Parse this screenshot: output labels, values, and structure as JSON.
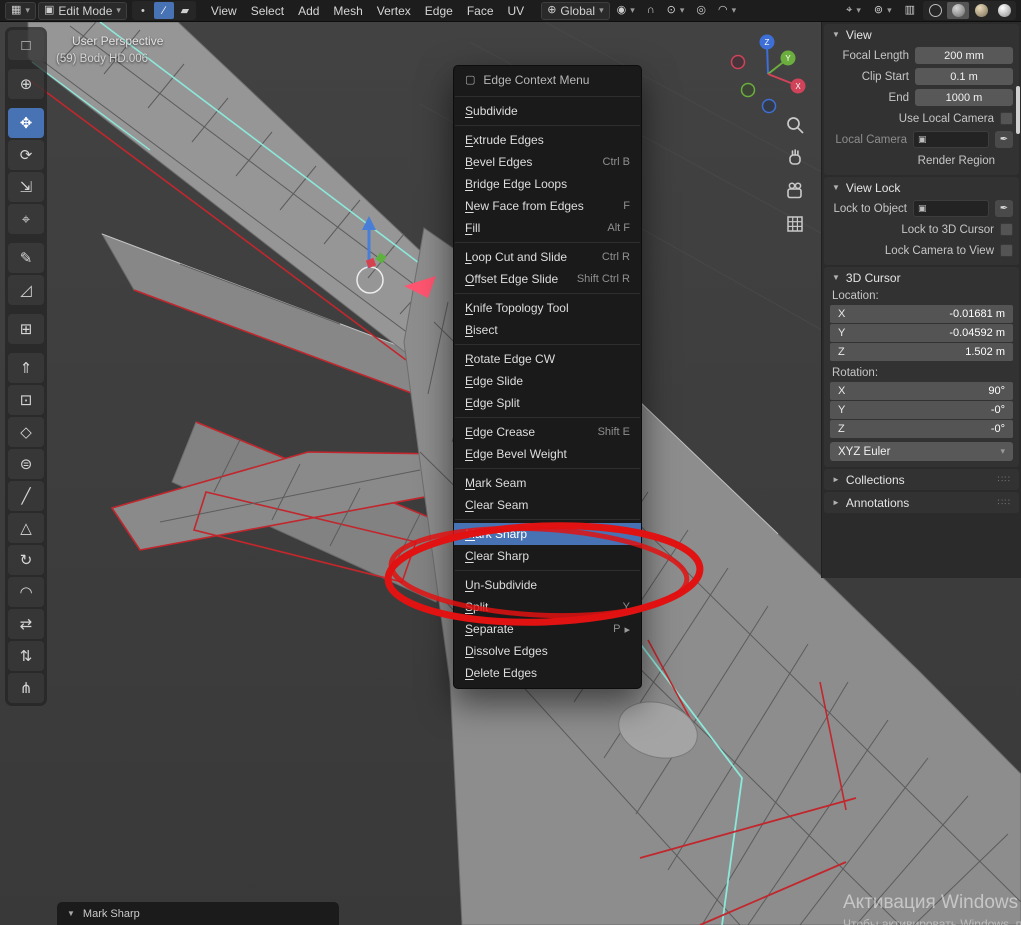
{
  "topbar": {
    "mode": "Edit Mode",
    "menus": [
      "View",
      "Select",
      "Add",
      "Mesh",
      "Vertex",
      "Edge",
      "Face",
      "UV"
    ],
    "orientation": "Global"
  },
  "icons": {
    "chevron_down": "▾",
    "editor_type": "▦",
    "mode_cube": "▣",
    "vertex_select": "•",
    "edge_select": "∕",
    "face_select": "▰",
    "orientation_globe": "⊕",
    "pivot_point": "◉",
    "snap_magnet": "∩",
    "snap_target": "⊙",
    "proportional_edit": "◎",
    "falloff": "◠",
    "gizmo_toggle": "⌖",
    "overlays_toggle": "⊚",
    "xray_toggle": "▥",
    "menu_header": "▢",
    "object_cube": "▣",
    "eyedropper": "✒",
    "triangle_down": "▼",
    "triangle_right": "►",
    "grip": "∷∷"
  },
  "viewport": {
    "perspective_label": "User Perspective",
    "object_label": "(59) Body HD.006",
    "axis_labels": {
      "x": "X",
      "y": "Y",
      "z": "Z"
    }
  },
  "colors": {
    "selection_blue": "#4772b3",
    "seam_red": "#c1272d",
    "sharp_cyan": "#8ce8da",
    "annotation_red": "#e11212"
  },
  "toolbox": {
    "tools": [
      {
        "name": "select-box",
        "glyph": "□"
      },
      {
        "name": "cursor",
        "glyph": "⊕",
        "gap": true
      },
      {
        "name": "move",
        "glyph": "✥",
        "gap": true,
        "active": true
      },
      {
        "name": "rotate",
        "glyph": "⟳"
      },
      {
        "name": "scale",
        "glyph": "⇲"
      },
      {
        "name": "transform",
        "glyph": "⌖"
      },
      {
        "name": "annotate",
        "glyph": "✎",
        "gap": true
      },
      {
        "name": "measure",
        "glyph": "◿"
      },
      {
        "name": "add-cube",
        "glyph": "⊞",
        "gap": true
      },
      {
        "name": "extrude-region",
        "glyph": "⇑",
        "gap": true
      },
      {
        "name": "inset-faces",
        "glyph": "⊡"
      },
      {
        "name": "bevel",
        "glyph": "◇"
      },
      {
        "name": "loop-cut",
        "glyph": "⊜"
      },
      {
        "name": "knife",
        "glyph": "╱"
      },
      {
        "name": "poly-build",
        "glyph": "△"
      },
      {
        "name": "spin",
        "glyph": "↻"
      },
      {
        "name": "smooth",
        "glyph": "◠"
      },
      {
        "name": "edge-slide",
        "glyph": "⇄"
      },
      {
        "name": "shrink-fatten",
        "glyph": "⇅"
      },
      {
        "name": "rip-region",
        "glyph": "⋔"
      }
    ]
  },
  "context_menu": {
    "title": "Edge Context Menu",
    "groups": [
      {
        "items": [
          {
            "label": "Subdivide"
          }
        ]
      },
      {
        "items": [
          {
            "label": "Extrude Edges"
          },
          {
            "label": "Bevel Edges",
            "shortcut": "Ctrl B"
          },
          {
            "label": "Bridge Edge Loops"
          },
          {
            "label": "New Face from Edges",
            "shortcut": "F"
          },
          {
            "label": "Fill",
            "shortcut": "Alt F"
          }
        ]
      },
      {
        "items": [
          {
            "label": "Loop Cut and Slide",
            "shortcut": "Ctrl R"
          },
          {
            "label": "Offset Edge Slide",
            "shortcut": "Shift Ctrl R"
          }
        ]
      },
      {
        "items": [
          {
            "label": "Knife Topology Tool"
          },
          {
            "label": "Bisect"
          }
        ]
      },
      {
        "items": [
          {
            "label": "Rotate Edge CW"
          },
          {
            "label": "Edge Slide"
          },
          {
            "label": "Edge Split"
          }
        ]
      },
      {
        "items": [
          {
            "label": "Edge Crease",
            "shortcut": "Shift E"
          },
          {
            "label": "Edge Bevel Weight"
          }
        ]
      },
      {
        "items": [
          {
            "label": "Mark Seam"
          },
          {
            "label": "Clear Seam"
          }
        ]
      },
      {
        "items": [
          {
            "label": "Mark Sharp",
            "selected": true
          },
          {
            "label": "Clear Sharp"
          }
        ]
      },
      {
        "items": [
          {
            "label": "Un-Subdivide"
          },
          {
            "label": "Split",
            "shortcut": "Y"
          },
          {
            "label": "Separate",
            "shortcut": "P",
            "submenu": true
          },
          {
            "label": "Dissolve Edges"
          },
          {
            "label": "Delete Edges"
          }
        ]
      }
    ]
  },
  "sidebar": {
    "view": {
      "title": "View",
      "focal": {
        "label": "Focal Length",
        "value": "200 mm"
      },
      "clip_start": {
        "label": "Clip Start",
        "value": "0.1 m"
      },
      "clip_end": {
        "label": "End",
        "value": "1000 m"
      },
      "use_local_camera": "Use Local Camera",
      "local_camera": "Local Camera",
      "render_region": "Render Region"
    },
    "view_lock": {
      "title": "View Lock",
      "lock_to_object": "Lock to Object",
      "lock_to_3d_cursor": "Lock to 3D Cursor",
      "lock_camera_to_view": "Lock Camera to View"
    },
    "cursor3d": {
      "title": "3D Cursor",
      "location_label": "Location:",
      "loc_x": {
        "axis": "X",
        "value": "-0.01681 m"
      },
      "loc_y": {
        "axis": "Y",
        "value": "-0.04592 m"
      },
      "loc_z": {
        "axis": "Z",
        "value": "1.502 m"
      },
      "rotation_label": "Rotation:",
      "rot_x": {
        "axis": "X",
        "value": "90°"
      },
      "rot_y": {
        "axis": "Y",
        "value": "-0°"
      },
      "rot_z": {
        "axis": "Z",
        "value": "-0°"
      },
      "rotation_mode": "XYZ Euler"
    },
    "collections_title": "Collections",
    "annotations_title": "Annotations"
  },
  "status": {
    "operator_panel": "Mark Sharp"
  },
  "watermark": {
    "title": "Активация Windows",
    "subtitle": "Чтобы активировать Windows, перейдите в раздел «Параметры»."
  }
}
